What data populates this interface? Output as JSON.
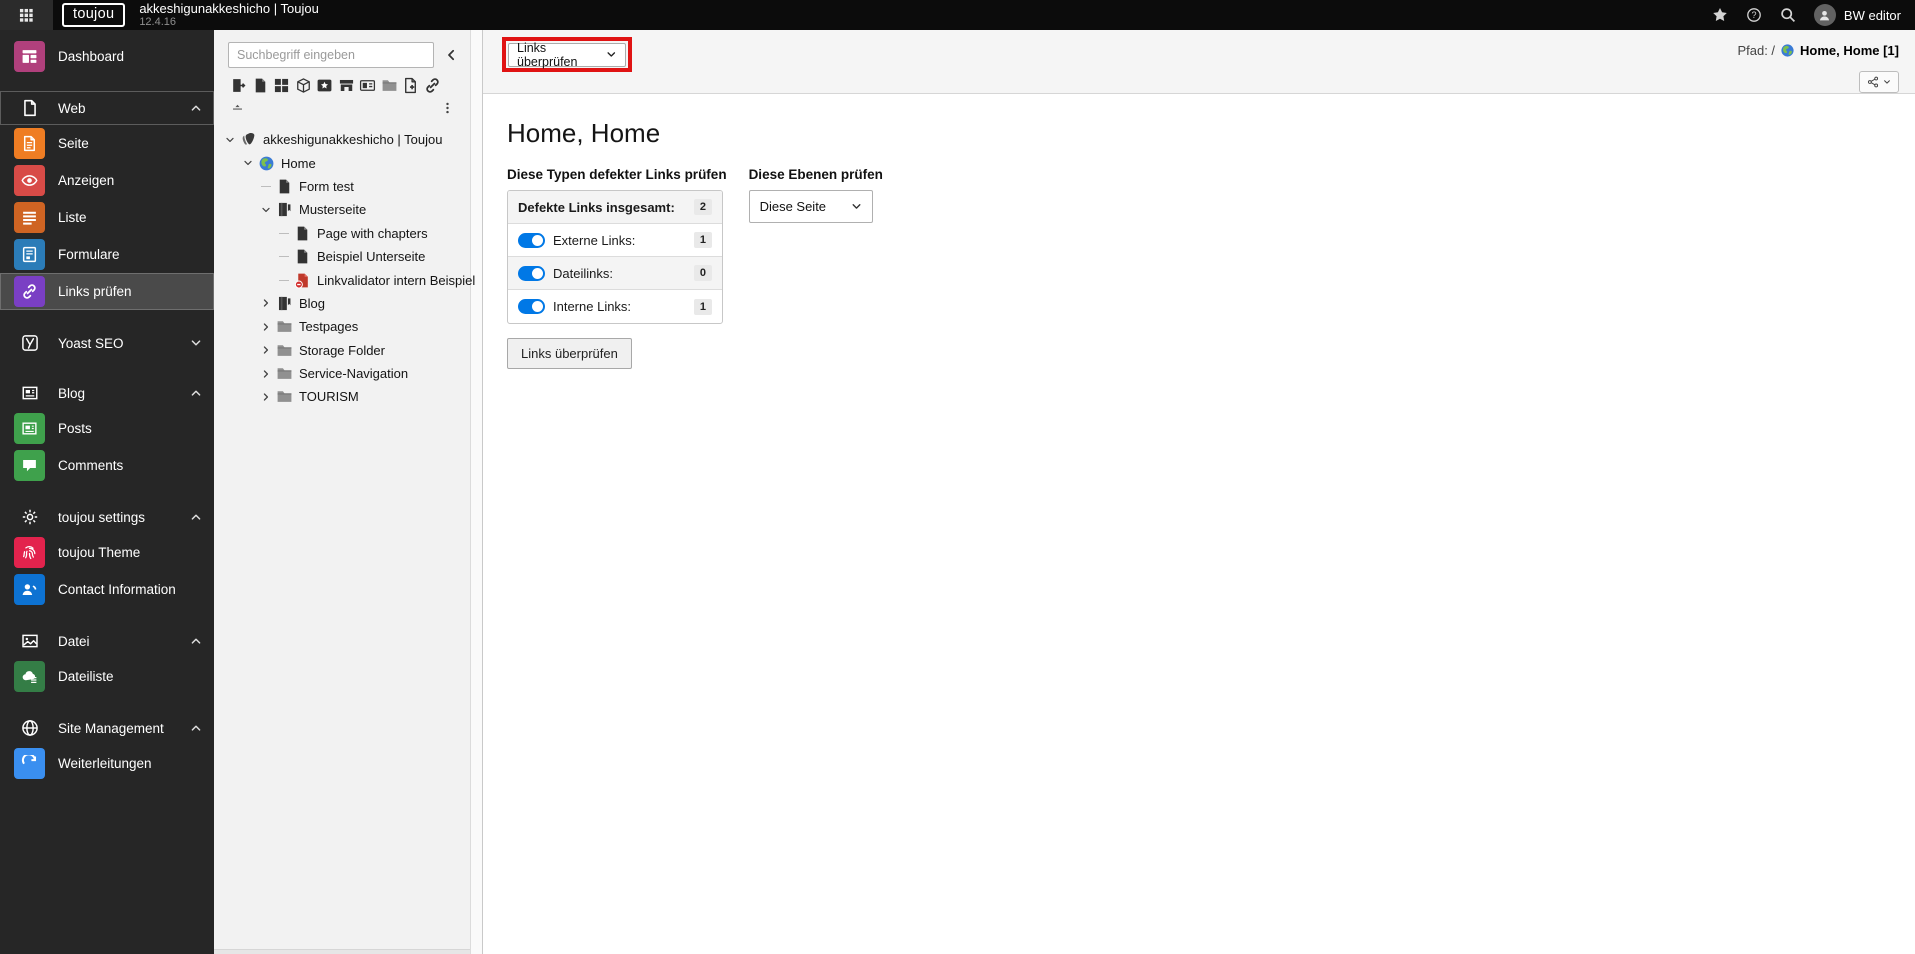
{
  "topbar": {
    "logo_text": "toujou",
    "site_title": "akkeshigunakkeshicho | Toujou",
    "version": "12.4.16",
    "user_name": "BW editor",
    "icons": {
      "menu": "apps-grid-icon",
      "star": "star-icon",
      "help": "help-icon",
      "search": "search-icon",
      "user": "user-icon"
    }
  },
  "sidebar": {
    "items": [
      {
        "type": "module",
        "label": "Dashboard",
        "icon": "dashboard-icon",
        "tile_color": "#b0407c"
      },
      {
        "type": "section",
        "label": "Web",
        "icon": "page-outline-icon",
        "chevron": "chevron-up-icon",
        "active_group": true
      },
      {
        "type": "module",
        "label": "Seite",
        "icon": "page-content-icon",
        "tile_color": "#ef7d23"
      },
      {
        "type": "module",
        "label": "Anzeigen",
        "icon": "eye-icon",
        "tile_color": "#d84b47"
      },
      {
        "type": "module",
        "label": "Liste",
        "icon": "list-icon",
        "tile_color": "#cf6423"
      },
      {
        "type": "module",
        "label": "Formulare",
        "icon": "form-icon",
        "tile_color": "#2b7cb8"
      },
      {
        "type": "module",
        "label": "Links prüfen",
        "icon": "link-icon",
        "tile_color": "#7a3fc4",
        "selected": true
      },
      {
        "type": "section",
        "label": "Yoast SEO",
        "icon": "yoast-icon",
        "chevron": "chevron-down-icon"
      },
      {
        "type": "section",
        "label": "Blog",
        "icon": "newspaper-icon",
        "chevron": "chevron-up-icon"
      },
      {
        "type": "module",
        "label": "Posts",
        "icon": "post-icon",
        "tile_color": "#3fa14c"
      },
      {
        "type": "module",
        "label": "Comments",
        "icon": "comment-icon",
        "tile_color": "#3fa14c"
      },
      {
        "type": "section",
        "label": "toujou settings",
        "icon": "gear-icon",
        "chevron": "chevron-up-icon"
      },
      {
        "type": "module",
        "label": "toujou Theme",
        "icon": "fingerprint-icon",
        "tile_color": "#e3234d"
      },
      {
        "type": "module",
        "label": "Contact Information",
        "icon": "contact-icon",
        "tile_color": "#0d72d2"
      },
      {
        "type": "section",
        "label": "Datei",
        "icon": "image-icon",
        "chevron": "chevron-up-icon"
      },
      {
        "type": "module",
        "label": "Dateiliste",
        "icon": "filelist-icon",
        "tile_color": "#347d46"
      },
      {
        "type": "section",
        "label": "Site Management",
        "icon": "globe-icon",
        "chevron": "chevron-up-icon"
      },
      {
        "type": "module",
        "label": "Weiterleitungen",
        "icon": "redirect-icon",
        "tile_color": "#3a8ff0"
      }
    ]
  },
  "pagetree": {
    "search_placeholder": "Suchbegriff eingeben",
    "icons": {
      "collapse": "chevron-left-icon",
      "split": "split-handle-icon",
      "more": "dots-vertical-icon"
    },
    "toolbar_icons": [
      "shortcut-page-icon",
      "page-dark-icon",
      "grid-icon",
      "cube-icon",
      "star-box-icon",
      "storefront-icon",
      "card-icon",
      "folder-icon",
      "page-plus-icon",
      "link-icon"
    ],
    "nodes": [
      {
        "level": 0,
        "label": "akkeshigunakkeshicho | Toujou",
        "icon": "typo3-icon",
        "expander": "chevron-down-icon"
      },
      {
        "level": 1,
        "label": "Home",
        "icon": "globe-color-icon",
        "expander": "chevron-down-icon"
      },
      {
        "level": 2,
        "label": "Form test",
        "icon": "page-dark-icon",
        "expander": "line"
      },
      {
        "level": 2,
        "label": "Musterseite",
        "icon": "page-flag-icon",
        "expander": "chevron-down-icon"
      },
      {
        "level": 3,
        "label": "Page with chapters",
        "icon": "page-dark-icon",
        "expander": "line"
      },
      {
        "level": 3,
        "label": "Beispiel Unterseite",
        "icon": "page-dark-icon",
        "expander": "line"
      },
      {
        "level": 3,
        "label": "Linkvalidator intern Beispiel",
        "icon": "page-error-icon",
        "expander": "line"
      },
      {
        "level": 2,
        "label": "Blog",
        "icon": "page-flag-icon",
        "expander": "chevron-right-icon"
      },
      {
        "level": 2,
        "label": "Testpages",
        "icon": "folder-icon",
        "expander": "chevron-right-icon"
      },
      {
        "level": 2,
        "label": "Storage Folder",
        "icon": "folder-icon",
        "expander": "chevron-right-icon"
      },
      {
        "level": 2,
        "label": "Service-Navigation",
        "icon": "folder-icon",
        "expander": "chevron-right-icon"
      },
      {
        "level": 2,
        "label": "TOURISM",
        "icon": "folder-icon",
        "expander": "chevron-right-icon"
      }
    ]
  },
  "docheader": {
    "module_dropdown": {
      "label": "Links überprüfen"
    },
    "path_prefix": "Pfad: /",
    "path_page": "Home, Home [1]",
    "icons": {
      "dropdown_caret": "chevron-down-icon",
      "page": "globe-color-icon",
      "share": "share-icon",
      "share_caret": "chevron-down-icon"
    }
  },
  "main": {
    "title": "Home, Home",
    "left_section": {
      "heading": "Diese Typen defekter Links prüfen",
      "rows": [
        {
          "label": "Defekte Links insgesamt:",
          "count": "2",
          "toggle": null,
          "bold": true
        },
        {
          "label": "Externe Links:",
          "count": "1",
          "toggle": true
        },
        {
          "label": "Dateilinks:",
          "count": "0",
          "toggle": true
        },
        {
          "label": "Interne Links:",
          "count": "1",
          "toggle": true
        }
      ],
      "check_button": "Links überprüfen"
    },
    "right_section": {
      "heading": "Diese Ebenen prüfen",
      "select_value": "Diese Seite",
      "select_caret": "chevron-down-icon"
    },
    "accent_colors": {
      "toggle_on": "#0078e6",
      "highlight_red": "#e01313"
    }
  }
}
